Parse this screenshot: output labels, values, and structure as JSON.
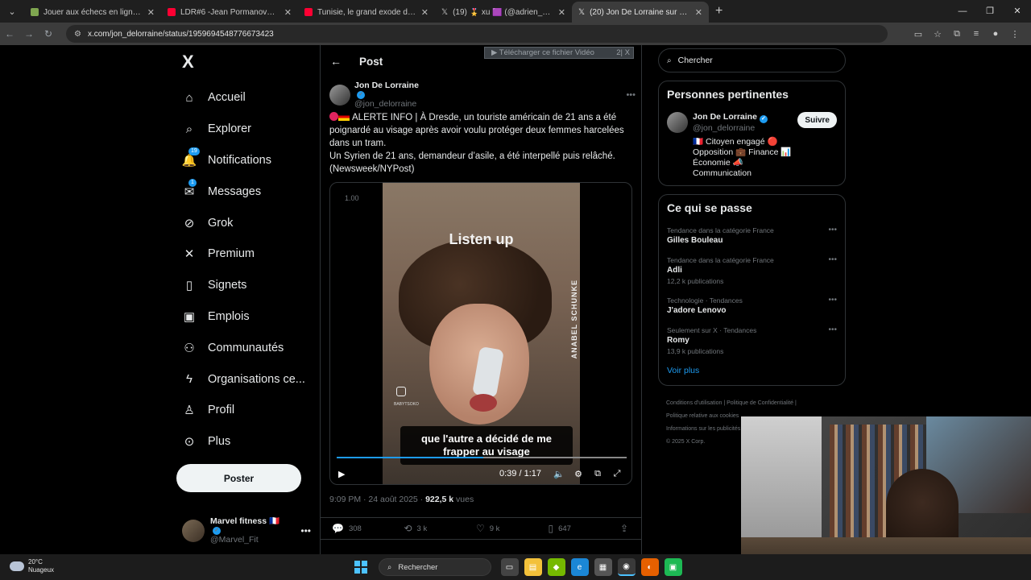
{
  "browser": {
    "tabs": [
      {
        "title": "Jouer aux échecs en ligne contr",
        "color": "#7fa650"
      },
      {
        "title": "LDR#6 -Jean Pormanove - Enqu",
        "color": "#ff0033"
      },
      {
        "title": "Tunisie, le grand exode des mé",
        "color": "#ff0033"
      },
      {
        "title": "(19) 🎖️ xu 🟪 (@adrien_bocque",
        "color": "#e7e9ea"
      },
      {
        "title": "(20) Jon De Lorraine sur X : \"🔴",
        "color": "#e7e9ea"
      }
    ],
    "url": "x.com/jon_delorraine/status/1959694548776673423"
  },
  "nav": {
    "logo": "X",
    "items": [
      {
        "label": "Accueil",
        "icon": "home-icon",
        "glyph": "⌂"
      },
      {
        "label": "Explorer",
        "icon": "search-icon",
        "glyph": "⌕"
      },
      {
        "label": "Notifications",
        "icon": "bell-icon",
        "glyph": "🔔",
        "badge": "19"
      },
      {
        "label": "Messages",
        "icon": "mail-icon",
        "glyph": "✉",
        "badge": "1"
      },
      {
        "label": "Grok",
        "icon": "grok-icon",
        "glyph": "⊘"
      },
      {
        "label": "Premium",
        "icon": "x-premium-icon",
        "glyph": "✕"
      },
      {
        "label": "Signets",
        "icon": "bookmark-icon",
        "glyph": "▯"
      },
      {
        "label": "Emplois",
        "icon": "briefcase-icon",
        "glyph": "▣"
      },
      {
        "label": "Communautés",
        "icon": "communities-icon",
        "glyph": "⚇"
      },
      {
        "label": "Organisations ce...",
        "icon": "lightning-icon",
        "glyph": "ϟ"
      },
      {
        "label": "Profil",
        "icon": "profile-icon",
        "glyph": "♙"
      },
      {
        "label": "Plus",
        "icon": "more-circle-icon",
        "glyph": "⊙"
      }
    ],
    "post_button": "Poster",
    "account": {
      "name": "Marvel fitness 🇫🇷",
      "handle": "@Marvel_Fit"
    }
  },
  "post": {
    "header": "Post",
    "download_bar": "▶ Télécharger ce fichier Vidéo",
    "download_close": "2| X",
    "author": {
      "name": "Jon De Lorraine",
      "handle": "@jon_delorraine"
    },
    "text_line1": "ALERTE INFO | À Dresde, un touriste américain de 21 ans a été poignardé au visage après avoir voulu protéger deux femmes harcelées dans un tram.",
    "text_line2": "Un Syrien de 21 ans, demandeur d’asile, a été interpellé puis relâché.",
    "text_line3": "(Newsweek/NYPost)",
    "video": {
      "speed": "1.00",
      "overlay_title": "Listen up",
      "watermark": "ANABEL SCHUNKE",
      "insta_handle": "BABYTSOKO",
      "caption": "que l'autre a décidé de me frapper au visage",
      "time": "0:39 / 1:17",
      "progress": 0.506
    },
    "timestamp": "9:09 PM · 24 août 2025 · ",
    "views_count": "922,5 k",
    "views_label": " vues",
    "actions": {
      "replies": "308",
      "reposts": "3 k",
      "likes": "9 k",
      "bookmarks": "647"
    }
  },
  "sidebar": {
    "search_placeholder": "Chercher",
    "relevant": {
      "title": "Personnes pertinentes",
      "name": "Jon De Lorraine",
      "handle": "@jon_delorraine",
      "follow": "Suivre",
      "bio": "🇫🇷 Citoyen engagé 🔴 Opposition 💼 Finance 📊 Économie 📣 Communication"
    },
    "trends_title": "Ce qui se passe",
    "trends": [
      {
        "category": "Tendance dans la catégorie France",
        "name": "Gilles Bouleau",
        "count": ""
      },
      {
        "category": "Tendance dans la catégorie France",
        "name": "Adli",
        "count": "12,2 k publications"
      },
      {
        "category": "Technologie · Tendances",
        "name": "J'adore Lenovo",
        "count": ""
      },
      {
        "category": "Seulement sur X · Tendances",
        "name": "Romy",
        "count": "13,9 k publications"
      }
    ],
    "show_more": "Voir plus",
    "footer": [
      "Conditions d'utilisation  |  Politique de Confidentialité  |",
      "Politique relative aux cookies",
      "Informations sur les publicités",
      "© 2025 X Corp."
    ]
  },
  "taskbar": {
    "temperature": "20°C",
    "weather": "Nuageux",
    "search": "Rechercher"
  }
}
